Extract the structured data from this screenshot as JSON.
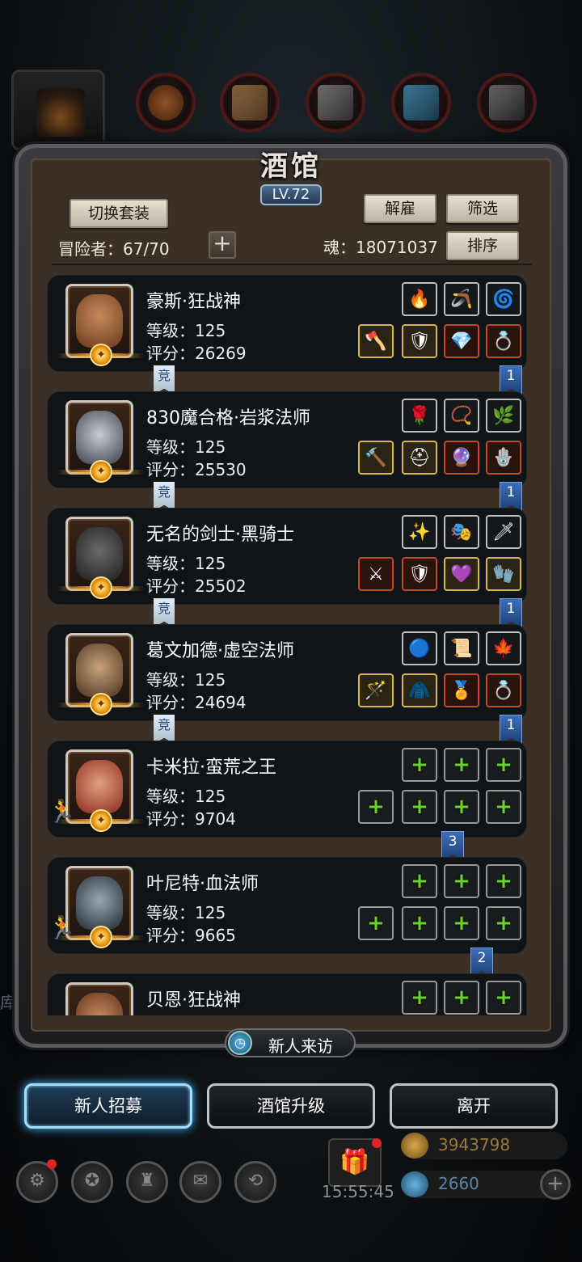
{
  "title": "酒馆",
  "level": "LV.72",
  "buttons": {
    "switch_set": "切换套装",
    "dismiss": "解雇",
    "filter": "筛选",
    "sort": "排序"
  },
  "header": {
    "adventurers": "冒险者：67/70",
    "soul": "魂：18071037"
  },
  "heroes": [
    {
      "name": "豪斯·狂战神",
      "level": "等级：125",
      "score": "评分：26269",
      "tag_left": "竞",
      "tag_right": "1",
      "icons_top": [
        "🔥",
        "🪃",
        "🌀"
      ],
      "icons_bottom": [
        "🪓",
        "🛡",
        "💎",
        "💍"
      ]
    },
    {
      "name": "830魔合格·岩浆法师",
      "level": "等级：125",
      "score": "评分：25530",
      "tag_left": "竞",
      "tag_right": "1",
      "icons_top": [
        "🌹",
        "📿",
        "🌿"
      ],
      "icons_bottom": [
        "🔨",
        "⛑",
        "🔮",
        "🪬"
      ]
    },
    {
      "name": "无名的剑士·黑骑士",
      "level": "等级：125",
      "score": "评分：25502",
      "tag_left": "竞",
      "tag_right": "1",
      "icons_top": [
        "✨",
        "🎭",
        "🗡"
      ],
      "icons_bottom": [
        "⚔",
        "🛡",
        "💜",
        "🧤"
      ]
    },
    {
      "name": "葛文加德·虚空法师",
      "level": "等级：125",
      "score": "评分：24694",
      "tag_left": "竞",
      "tag_right": "1",
      "icons_top": [
        "🔵",
        "📜",
        "🍁"
      ],
      "icons_bottom": [
        "🪄",
        "🧥",
        "🏅",
        "💍"
      ]
    },
    {
      "name": "卡米拉·蛮荒之王",
      "level": "等级：125",
      "score": "评分：9704",
      "tag_right": "3"
    },
    {
      "name": "叶尼特·血法师",
      "level": "等级：125",
      "score": "评分：9665",
      "tag_right": "2"
    },
    {
      "name": "贝恩·狂战神"
    }
  ],
  "visit_label": "新人来访",
  "bottom_buttons": {
    "recruit": "新人招募",
    "upgrade": "酒馆升级",
    "leave": "离开"
  },
  "background": {
    "gold": "3943798",
    "gems": "2660",
    "timer": "15:55:45",
    "side_char": "库"
  },
  "colors": {
    "panel": "#3a3027",
    "card": "#0f1418",
    "accent_blue": "#9fe0ff",
    "add_green": "#6bd42a"
  }
}
